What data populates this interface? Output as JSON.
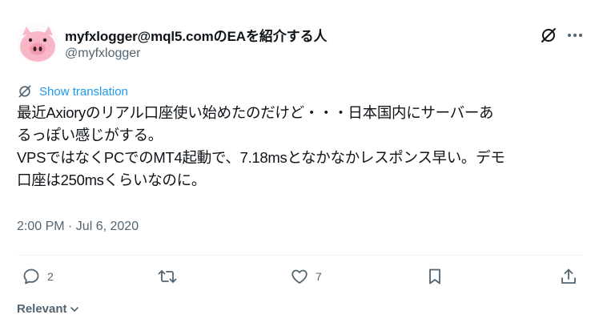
{
  "author": {
    "display_name": "myfxlogger@mql5.comのEAを紹介する人",
    "handle": "@myfxlogger"
  },
  "translation_link": "Show translation",
  "post_lines": [
    "最近Axioryのリアル口座使い始めたのだけど・・・日本国内にサーバーあ",
    "るっぽい感じがする。",
    "VPSではなくPCでのMT4起動で、7.18msとなかなかレスポンス早い。デモ",
    "口座は250msくらいなのに。"
  ],
  "timestamp": "2:00 PM · Jul 6, 2020",
  "actions": {
    "reply_count": "2",
    "repost_count": "",
    "like_count": "7"
  },
  "sort_label": "Relevant",
  "icons": [
    "pig-avatar",
    "grok-icon",
    "more-icon",
    "translate-icon",
    "reply-icon",
    "repost-icon",
    "like-icon",
    "bookmark-icon",
    "share-icon",
    "chevron-down-icon"
  ],
  "colors": {
    "link": "#1d9bf0",
    "secondary_text": "#536471",
    "primary_text": "#0f1419"
  }
}
